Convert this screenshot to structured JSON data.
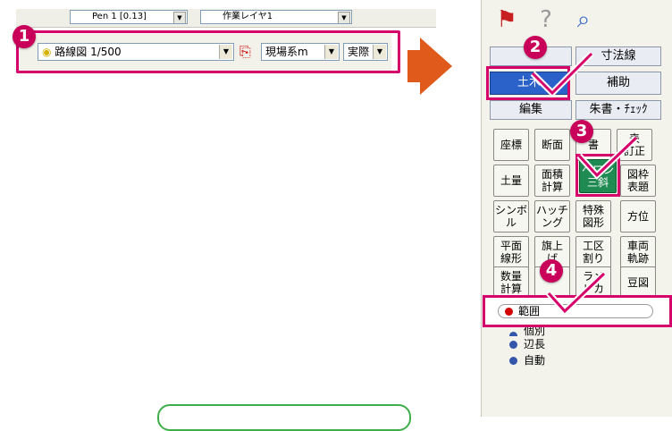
{
  "toolbar_top": {
    "pen_label": "Pen 1 [0.13]",
    "layer_label": "作業レイヤ1"
  },
  "toolbar_main": {
    "drawing_label": "路線図 1/500",
    "coord_system": "現場系m",
    "scale_mode": "実際"
  },
  "callouts": {
    "b1": "1",
    "b2": "2",
    "b3": "3",
    "b4": "4"
  },
  "palette": {
    "tabs": {
      "dimension": "寸法線",
      "civil": "土木",
      "auxiliary": "補助",
      "edit": "編集",
      "red_check": "朱書・ﾁｪｯｸ"
    },
    "buttons": [
      "座標",
      "断面",
      "書",
      "表\n訂正",
      "土量",
      "面積\n計算",
      "ヘロン\n三斜",
      "図枠\n表題",
      "シンボ\nル",
      "ハッチ\nング",
      "特殊\n図形",
      "方位",
      "平面\n線形",
      "旗上\nげ",
      "工区\n割り",
      "車両\n軌跡",
      "数量\n計算",
      "",
      "ラメ\nリカ",
      "豆図"
    ],
    "range_label": "範囲",
    "options": [
      "個別",
      "辺長",
      "自動"
    ]
  },
  "colors": {
    "accent": "#d6006b",
    "arrow": "#e05a1c",
    "active_tab": "#2a62c9",
    "green_button": "#1f8a52"
  },
  "icons": [
    "pin-icon",
    "help-icon",
    "zoom-icon",
    "bulb-icon",
    "layer-icon"
  ]
}
